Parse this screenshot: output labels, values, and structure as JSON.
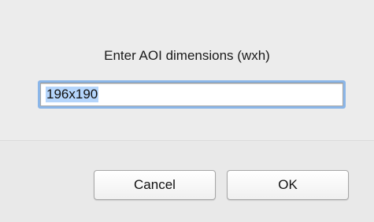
{
  "dialog": {
    "prompt": "Enter AOI dimensions (wxh)",
    "input_value": "196x190",
    "cancel_label": "Cancel",
    "ok_label": "OK"
  }
}
